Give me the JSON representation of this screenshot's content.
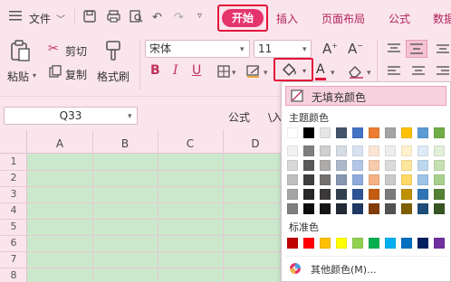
{
  "menubar": {
    "menu_icon": "hamburger-icon",
    "file_label": "文件",
    "tabs": [
      "开始",
      "插入",
      "页面布局",
      "公式",
      "数据"
    ]
  },
  "ribbon": {
    "paste_label": "粘贴",
    "cut_label": "剪切",
    "copy_label": "复制",
    "format_painter_label": "格式刷",
    "font_name": "宋体",
    "font_size": "11"
  },
  "formulabar": {
    "cell_ref": "Q33",
    "formula_label": "公式",
    "extra_label": "\\入"
  },
  "grid": {
    "columns": [
      "A",
      "B",
      "C",
      "D"
    ],
    "rows": [
      "1",
      "2",
      "3",
      "4",
      "5",
      "6",
      "7",
      "8"
    ],
    "fill_color": "#cce8cc"
  },
  "fill_menu": {
    "no_fill_label": "无填充颜色",
    "theme_label": "主题颜色",
    "standard_label": "标准色",
    "more_colors_label": "其他颜色(M)...",
    "theme_top_row": [
      "#ffffff",
      "#000000",
      "#e7e6e6",
      "#44546a",
      "#4472c4",
      "#ed7d31",
      "#a5a5a5",
      "#ffc000",
      "#5b9bd5",
      "#70ad47"
    ],
    "theme_shades": [
      [
        "#f2f2f2",
        "#7f7f7f",
        "#d0cece",
        "#d6dce4",
        "#d9e2f3",
        "#fbe5d5",
        "#ededed",
        "#fff2cc",
        "#deebf6",
        "#e2efd9"
      ],
      [
        "#d8d8d8",
        "#595959",
        "#aeabab",
        "#adb9ca",
        "#b4c6e7",
        "#f7cbac",
        "#dbdbdb",
        "#fee599",
        "#bdd7ee",
        "#c5e0b3"
      ],
      [
        "#bfbfbf",
        "#3f3f3f",
        "#757070",
        "#8496b0",
        "#8eaadb",
        "#f4b183",
        "#c9c9c9",
        "#ffd965",
        "#9dc3e6",
        "#a8d08d"
      ],
      [
        "#a5a5a5",
        "#262626",
        "#3a3838",
        "#323f4f",
        "#2f5496",
        "#c55a11",
        "#7b7b7b",
        "#bf9000",
        "#2e75b5",
        "#538135"
      ],
      [
        "#7f7f7f",
        "#0c0c0c",
        "#171616",
        "#222a35",
        "#1f3864",
        "#833c0b",
        "#525252",
        "#7f6000",
        "#1e4e79",
        "#375623"
      ]
    ],
    "standard_colors": [
      "#c00000",
      "#ff0000",
      "#ffc000",
      "#ffff00",
      "#92d050",
      "#00b050",
      "#00b0f0",
      "#0070c0",
      "#002060",
      "#7030a0"
    ]
  }
}
